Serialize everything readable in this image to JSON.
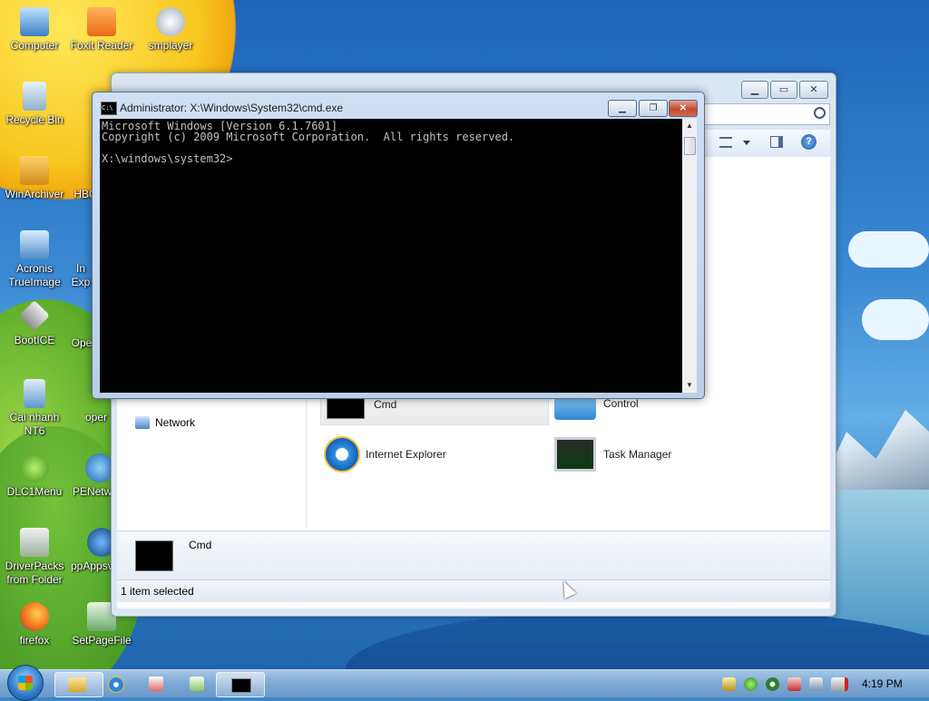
{
  "desktop": {
    "icons": [
      {
        "label": "Computer",
        "icon": "computer-icon"
      },
      {
        "label": "Foxit Reader",
        "icon": "pdf-icon"
      },
      {
        "label": "smplayer",
        "icon": "media-player-icon"
      },
      {
        "label": "Recycle Bin",
        "icon": "recycle-bin-icon"
      },
      {
        "label": "WinArchiver",
        "icon": "archive-icon"
      },
      {
        "label": "HBC",
        "icon": "app-icon"
      },
      {
        "label": "Acronis TrueImage",
        "icon": "backup-icon"
      },
      {
        "label": "In Exp",
        "icon": "app-icon"
      },
      {
        "label": "BootICE",
        "icon": "boot-icon"
      },
      {
        "label": "Ope",
        "icon": "app-icon"
      },
      {
        "label": "Cai nhanh NT6",
        "icon": "installer-icon"
      },
      {
        "label": "oper",
        "icon": "app-icon"
      },
      {
        "label": "DLC1Menu",
        "icon": "menu-icon"
      },
      {
        "label": "PENetw",
        "icon": "network-icon"
      },
      {
        "label": "DriverPacks from Folder",
        "icon": "driver-icon"
      },
      {
        "label": "ppAppsv",
        "icon": "app-icon"
      },
      {
        "label": "firefox",
        "icon": "firefox-icon"
      },
      {
        "label": "SetPageFile",
        "icon": "pagefile-icon"
      }
    ]
  },
  "cmd": {
    "title": "Administrator: X:\\Windows\\System32\\cmd.exe",
    "console_text": "Microsoft Windows [Version 6.1.7601]\nCopyright (c) 2009 Microsoft Corporation.  All rights reserved.\n\nX:\\windows\\system32>",
    "minimize_label": "▁",
    "maximize_label": "❐",
    "close_label": "✕"
  },
  "explorer": {
    "minimize_label": "▁",
    "maximize_label": "▭",
    "close_label": "✕",
    "nav_network": "Network",
    "items": [
      {
        "label": "Cmd",
        "icon": "cmd-icon",
        "selected": true
      },
      {
        "label": "Control",
        "icon": "control-panel-icon"
      },
      {
        "label": "Internet Explorer",
        "icon": "internet-explorer-icon"
      },
      {
        "label": "Task Manager",
        "icon": "task-manager-icon"
      }
    ],
    "details_name": "Cmd",
    "status_text": "1 item selected"
  },
  "taskbar": {
    "clock": "4:19 PM"
  },
  "colors": {
    "console_bg": "#000000",
    "console_fg": "#c0c0c0",
    "close_red": "#c44a2e"
  }
}
